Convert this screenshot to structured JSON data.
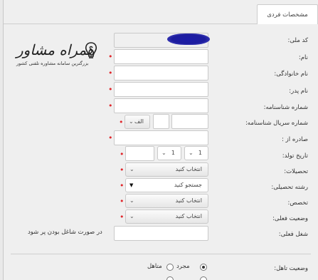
{
  "tab": {
    "label": "مشخصات فردی"
  },
  "logo": {
    "title": "همراه مشاور",
    "subtitle": "بزرگترین سامانه مشاوره تلفنی کشور"
  },
  "fields": {
    "code_meli": "کد ملی:",
    "name": "نام:",
    "family": "نام خانوادگی:",
    "father": "نام پدر:",
    "id_number": "شماره شناسنامه:",
    "id_serial": "شماره سریال شناسنامه:",
    "issued": "صادره از :",
    "birth": "تاریخ تولد:",
    "education": "تحصیلات:",
    "major": "رشته تحصیلی:",
    "specialty": "تخصص:",
    "status": "وضعیت فعلی:",
    "job": "شغل فعلی:",
    "marital": "وضعیت تاهل:"
  },
  "serial_letter": "الف",
  "birth": {
    "day": "1",
    "month": "1",
    "year": ""
  },
  "selects": {
    "education": "انتخاب کنید",
    "major": "جستجو کنید",
    "specialty": "انتخاب کنید",
    "status": "انتخاب کنید"
  },
  "job_note": "در صورت شاغل بودن پر شود",
  "marital": {
    "single": "مجرد",
    "married": "متاهل",
    "selected": "single"
  },
  "colors": {
    "required": "#e0272c",
    "mask": "#1c1c9e"
  }
}
